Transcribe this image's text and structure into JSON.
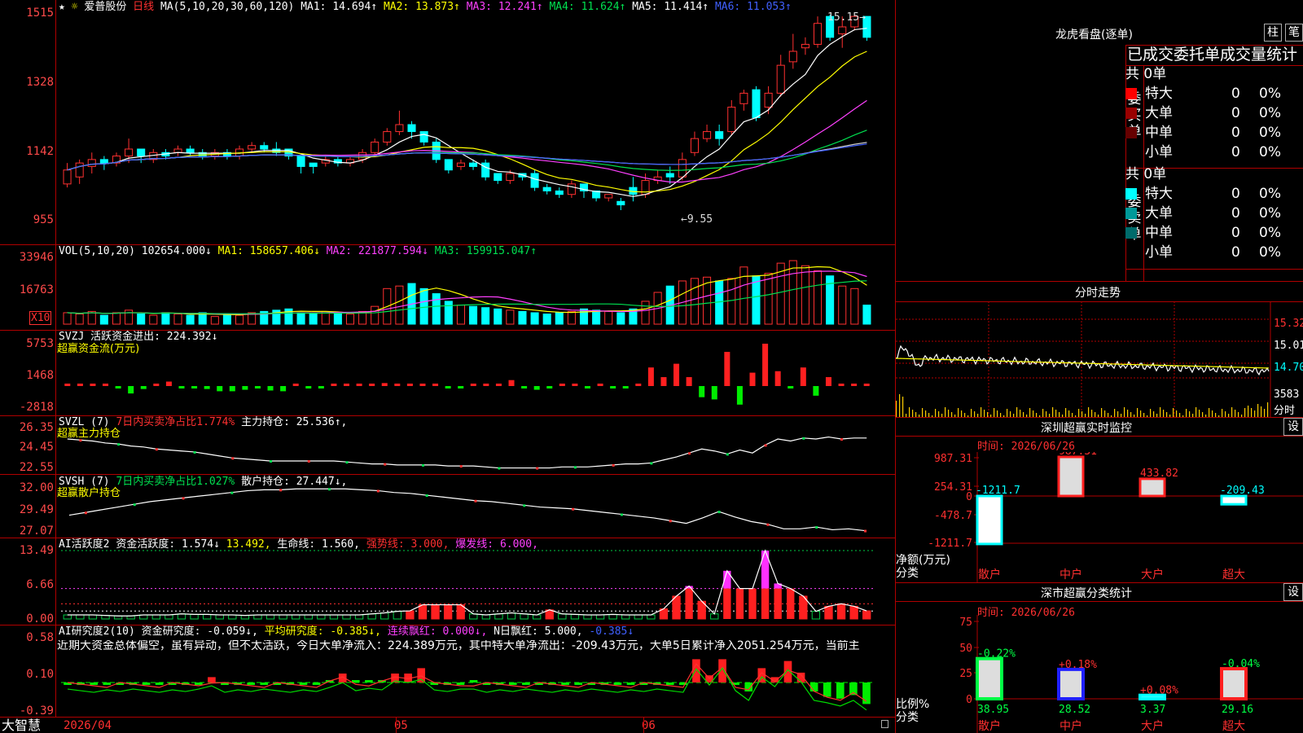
{
  "header": {
    "star": "★",
    "gear": "☼",
    "stock_name": "爱普股份",
    "period": "日线",
    "ma_label": "MA(5,10,20,30,60,120)",
    "ma1": "MA1: 14.694↑",
    "ma2": "MA2: 13.873↑",
    "ma3": "MA3: 12.241↑",
    "ma4": "MA4: 11.624↑",
    "ma5": "MA5: 11.414↑",
    "ma6": "MA6: 11.053↑"
  },
  "price_panel": {
    "ticks": [
      "1515",
      "1328",
      "1142",
      "955"
    ],
    "high_label": "15.15→",
    "low_label": "←9.55"
  },
  "vol_panel": {
    "title": "VOL(5,10,20)",
    "value": "102654.000↓",
    "ma1": "MA1: 158657.406↓",
    "ma2": "MA2: 221877.594↓",
    "ma3": "MA3: 159915.047↑",
    "ticks": [
      "33946",
      "16763"
    ],
    "unit": "X10"
  },
  "svzj_panel": {
    "title": "SVZJ",
    "desc": "活跃资金进出: 224.392↓",
    "sub": "超赢资金流(万元)",
    "ticks": [
      "5753",
      "1468",
      "-2818"
    ]
  },
  "svzl_panel": {
    "title": "SVZL (7)",
    "desc": "7日内买卖净占比1.774%",
    "desc2": "主力持仓: 25.536↑,",
    "sub": "超赢主力持仓",
    "ticks": [
      "26.35",
      "24.45",
      "22.55"
    ]
  },
  "svsh_panel": {
    "title": "SVSH (7)",
    "desc": "7日内买卖净占比1.027%",
    "desc2": "散户持仓: 27.447↓,",
    "sub": "超赢散户持仓",
    "ticks": [
      "32.00",
      "29.49",
      "27.07"
    ]
  },
  "ai1_panel": {
    "title": "AI活跃度2",
    "desc": "资金活跃度: 1.574↓",
    "v2": "13.492,",
    "v3": "生命线: 1.560,",
    "v4": "强势线: 3.000,",
    "v5": "爆发线: 6.000,",
    "ticks": [
      "13.49",
      "6.66",
      "0.00"
    ]
  },
  "ai2_panel": {
    "title": "AI研究度2(10)",
    "desc": "资金研究度: -0.059↓,",
    "v2": "平均研究度: -0.385↓,",
    "v3": "连续飘红: 0.000↓,",
    "v4": "N日飘红: 5.000,",
    "v5": "-0.385↓",
    "commentary": "近期大资金总体偏空，虽有异动，但不太活跃，今日大单净流入：224.389万元，其中特大单净流出：-209.43万元，大单5日累计净入2051.254万元，当前主",
    "ticks": [
      "0.58",
      "0.10",
      "-0.39"
    ]
  },
  "bottom_bar": {
    "brand": "大智慧",
    "date_start": "2026/04",
    "m05": "05",
    "m06": "06"
  },
  "longhu": {
    "title": "龙虎看盘(逐单)",
    "btn1": "柱",
    "btn2": "笔",
    "header": "已成交委托单成交量统计",
    "buy": {
      "label": "委买单",
      "total": "共 0单",
      "rows": [
        {
          "name": "特大",
          "v": "0",
          "p": "0%",
          "color": "#ff0000"
        },
        {
          "name": "大单",
          "v": "0",
          "p": "0%",
          "color": "#990000"
        },
        {
          "name": "中单",
          "v": "0",
          "p": "0%",
          "color": "#660000"
        },
        {
          "name": "小单",
          "v": "0",
          "p": "0%",
          "color": ""
        }
      ]
    },
    "sell": {
      "label": "委卖单",
      "total": "共 0单",
      "rows": [
        {
          "name": "特大",
          "v": "0",
          "p": "0%",
          "color": "#00ffff"
        },
        {
          "name": "大单",
          "v": "0",
          "p": "0%",
          "color": "#009999"
        },
        {
          "name": "中单",
          "v": "0",
          "p": "0%",
          "color": "#006b6b"
        },
        {
          "name": "小单",
          "v": "0",
          "p": "0%",
          "color": ""
        }
      ]
    }
  },
  "intraday": {
    "title": "分时走势",
    "ticks": [
      "15.32",
      "15.01",
      "14.70",
      "3583",
      "分时"
    ]
  },
  "sz_monitor": {
    "title": "深圳超赢实时监控",
    "btn": "设",
    "time": "时间: 2026/06/26",
    "yticks": [
      "987.31",
      "254.31",
      "0",
      "-478.7",
      "-1211.7"
    ],
    "ylabel": "净额(万元)",
    "xlabel": "分类",
    "bars": [
      {
        "cat": "散户",
        "value": -1211.7,
        "label": "-1211.7"
      },
      {
        "cat": "中户",
        "value": 987.31,
        "label": "987.31"
      },
      {
        "cat": "大户",
        "value": 433.82,
        "label": "433.82"
      },
      {
        "cat": "超大",
        "value": -209.43,
        "label": "-209.43"
      }
    ]
  },
  "sz_class": {
    "title": "深市超赢分类统计",
    "btn": "设",
    "time": "时间: 2026/06/26",
    "yticks": [
      "75",
      "50",
      "25",
      "0"
    ],
    "ylabel": "比例%",
    "xlabel": "分类",
    "bars": [
      {
        "cat": "散户",
        "value": 38.95,
        "change": "-0.22%",
        "color": "#00ff44"
      },
      {
        "cat": "中户",
        "value": 28.52,
        "change": "+0.18%",
        "color": "#2020ff"
      },
      {
        "cat": "大户",
        "value": 3.37,
        "change": "+0.08%",
        "color": "#00ffff"
      },
      {
        "cat": "超大",
        "value": 29.16,
        "change": "-0.04%",
        "color": "#ff2020"
      }
    ]
  },
  "chart_data": {
    "type": "candlestick",
    "title": "爱普股份 日线",
    "y_range": [
      9.55,
      15.15
    ],
    "x_months": [
      "2026/04",
      "05",
      "06"
    ],
    "candles": [
      [
        10.3,
        10.7,
        10.2,
        10.9
      ],
      [
        10.5,
        10.9,
        10.3,
        11.0
      ],
      [
        10.8,
        11.0,
        10.6,
        11.2
      ],
      [
        11.0,
        10.9,
        10.7,
        11.1
      ],
      [
        10.9,
        11.1,
        10.8,
        11.2
      ],
      [
        11.1,
        11.3,
        10.9,
        11.6
      ],
      [
        11.3,
        11.1,
        10.9,
        11.3
      ],
      [
        11.0,
        11.2,
        10.9,
        11.3
      ],
      [
        11.2,
        11.1,
        11.0,
        11.3
      ],
      [
        11.2,
        11.3,
        11.1,
        11.4
      ],
      [
        11.3,
        11.2,
        11.1,
        11.4
      ],
      [
        11.2,
        11.1,
        11.0,
        11.3
      ],
      [
        11.1,
        11.2,
        11.0,
        11.3
      ],
      [
        11.2,
        11.1,
        11.0,
        11.3
      ],
      [
        11.1,
        11.3,
        11.0,
        11.4
      ],
      [
        11.3,
        11.4,
        11.2,
        11.5
      ],
      [
        11.4,
        11.3,
        11.2,
        11.5
      ],
      [
        11.3,
        11.2,
        11.1,
        11.5
      ],
      [
        11.3,
        11.1,
        11.0,
        11.3
      ],
      [
        11.1,
        10.8,
        10.6,
        11.1
      ],
      [
        10.9,
        10.8,
        10.6,
        10.9
      ],
      [
        10.9,
        11.0,
        10.8,
        11.1
      ],
      [
        11.0,
        10.9,
        10.8,
        11.1
      ],
      [
        10.9,
        11.0,
        10.8,
        11.1
      ],
      [
        11.0,
        11.2,
        10.9,
        11.3
      ],
      [
        11.2,
        11.5,
        11.1,
        11.6
      ],
      [
        11.5,
        11.8,
        11.4,
        11.9
      ],
      [
        11.8,
        12.0,
        11.7,
        12.4
      ],
      [
        12.0,
        11.8,
        11.6,
        12.1
      ],
      [
        11.8,
        11.5,
        11.4,
        11.8
      ],
      [
        11.5,
        11.0,
        10.9,
        11.6
      ],
      [
        11.0,
        10.7,
        10.6,
        11.0
      ],
      [
        10.8,
        10.9,
        10.7,
        11.0
      ],
      [
        10.9,
        10.8,
        10.7,
        11.0
      ],
      [
        10.9,
        10.5,
        10.4,
        11.0
      ],
      [
        10.6,
        10.4,
        10.3,
        10.6
      ],
      [
        10.4,
        10.6,
        10.3,
        10.7
      ],
      [
        10.6,
        10.5,
        10.4,
        10.6
      ],
      [
        10.6,
        10.2,
        10.1,
        10.7
      ],
      [
        10.2,
        10.1,
        10.0,
        10.3
      ],
      [
        10.1,
        10.0,
        9.9,
        10.2
      ],
      [
        10.0,
        10.3,
        9.9,
        10.4
      ],
      [
        10.3,
        10.1,
        9.9,
        10.3
      ],
      [
        10.1,
        9.9,
        9.8,
        10.1
      ],
      [
        9.9,
        10.0,
        9.8,
        10.0
      ],
      [
        9.8,
        9.7,
        9.55,
        9.9
      ],
      [
        10.2,
        10.0,
        9.8,
        10.5
      ],
      [
        10.0,
        10.4,
        9.9,
        10.6
      ],
      [
        10.4,
        10.5,
        10.3,
        10.7
      ],
      [
        10.6,
        10.5,
        10.3,
        10.8
      ],
      [
        10.5,
        11.0,
        10.4,
        11.2
      ],
      [
        11.2,
        11.6,
        11.1,
        11.8
      ],
      [
        11.6,
        11.8,
        11.5,
        12.0
      ],
      [
        11.8,
        11.6,
        11.4,
        12.0
      ],
      [
        11.8,
        12.5,
        11.7,
        12.7
      ],
      [
        12.6,
        12.9,
        12.4,
        13.0
      ],
      [
        13.0,
        12.2,
        12.1,
        13.1
      ],
      [
        12.5,
        12.9,
        12.3,
        13.1
      ],
      [
        12.9,
        13.7,
        12.8,
        14.0
      ],
      [
        13.8,
        14.1,
        13.6,
        14.6
      ],
      [
        14.2,
        14.3,
        14.0,
        14.5
      ],
      [
        14.3,
        14.9,
        14.2,
        15.1
      ],
      [
        15.1,
        14.5,
        14.4,
        15.15
      ],
      [
        14.6,
        14.8,
        14.2,
        15.1
      ],
      [
        14.8,
        15.1,
        14.7,
        15.15
      ],
      [
        15.1,
        14.5,
        14.4,
        15.1
      ]
    ],
    "volume": [
      9000,
      8000,
      10000,
      7000,
      9000,
      11000,
      8000,
      7000,
      9000,
      8000,
      7000,
      9000,
      6000,
      8000,
      7000,
      9000,
      10000,
      11000,
      12000,
      9000,
      8000,
      10000,
      9000,
      8000,
      10000,
      14000,
      28000,
      30000,
      32000,
      28000,
      24000,
      18000,
      15000,
      14000,
      13000,
      12000,
      11000,
      10000,
      9000,
      8000,
      9000,
      10000,
      12000,
      11000,
      10000,
      9000,
      12000,
      18000,
      25000,
      30000,
      34000,
      36000,
      37000,
      34000,
      36000,
      45000,
      38000,
      40000,
      48000,
      50000,
      46000,
      42000,
      38000,
      30000,
      28000,
      15000
    ],
    "svzj": [
      0,
      0,
      0,
      0,
      -200,
      -1000,
      -400,
      0,
      600,
      -200,
      -300,
      -400,
      -700,
      -700,
      -500,
      -300,
      -600,
      -700,
      0,
      -200,
      -300,
      0,
      0,
      0,
      200,
      400,
      300,
      300,
      300,
      200,
      -200,
      -100,
      0,
      0,
      0,
      800,
      -200,
      -500,
      -100,
      300,
      0,
      -200,
      0,
      -100,
      -200,
      0,
      2500,
      1200,
      3000,
      1200,
      -1500,
      -1800,
      4600,
      -2500,
      1800,
      5700,
      2000,
      -300,
      2500,
      -1300,
      1200,
      300,
      0,
      0
    ],
    "svzl": [
      25.5,
      25.4,
      25.3,
      25.1,
      25.0,
      24.8,
      24.7,
      24.5,
      24.4,
      24.3,
      24.2,
      24.0,
      23.8,
      23.6,
      23.5,
      23.4,
      23.3,
      23.3,
      23.3,
      23.3,
      23.3,
      23.3,
      23.2,
      23.1,
      23.0,
      23.0,
      22.9,
      22.9,
      22.9,
      22.9,
      22.8,
      22.8,
      22.8,
      22.7,
      22.6,
      22.6,
      22.6,
      22.6,
      22.6,
      22.7,
      22.7,
      22.7,
      22.8,
      22.9,
      23.0,
      23.0,
      23.1,
      23.4,
      23.7,
      24.1,
      24.5,
      24.3,
      24.0,
      24.4,
      24.1,
      24.9,
      25.5,
      25.3,
      25.6,
      25.5,
      25.7,
      25.5,
      25.6,
      25.6
    ],
    "svsh": [
      29.1,
      29.4,
      29.7,
      30.0,
      30.3,
      30.6,
      30.8,
      31.0,
      31.2,
      31.4,
      31.6,
      31.8,
      31.9,
      31.9,
      32.0,
      32.0,
      32.0,
      32.0,
      31.9,
      31.8,
      31.6,
      31.5,
      31.3,
      31.1,
      30.9,
      30.7,
      30.6,
      30.4,
      30.2,
      30.0,
      29.9,
      29.8,
      29.6,
      29.4,
      29.2,
      29.0,
      28.8,
      28.5,
      28.2,
      28.8,
      29.5,
      28.9,
      28.4,
      28.1,
      27.6,
      27.6,
      27.8,
      27.5,
      27.6,
      27.4
    ],
    "ai1": [
      0.8,
      0.8,
      0.8,
      0.7,
      0.6,
      0.6,
      0.8,
      0.8,
      0.8,
      1.0,
      0.9,
      0.9,
      0.8,
      0.8,
      0.7,
      0.8,
      0.8,
      0.8,
      0.8,
      0.8,
      0.8,
      0.8,
      0.8,
      0.8,
      1.0,
      1.2,
      1.5,
      1.6,
      2.8,
      2.8,
      2.8,
      2.8,
      1.0,
      0.8,
      1.0,
      1.2,
      1.0,
      0.8,
      1.8,
      1.0,
      0.9,
      0.8,
      0.8,
      0.9,
      0.8,
      0.8,
      0.8,
      2.0,
      4.5,
      6.5,
      3.5,
      1.0,
      9.5,
      6.0,
      6.0,
      13.49,
      7.0,
      6.0,
      4.5,
      1.5,
      2.5,
      3.0,
      2.5,
      1.6
    ],
    "ai2": [
      0.04,
      0.04,
      0.04,
      0.04,
      0.04,
      0.04,
      0.04,
      0.04,
      0.04,
      0.04,
      0.04,
      0.1,
      0.04,
      0.04,
      0.04,
      0.04,
      0.04,
      0.04,
      0.04,
      0.04,
      0.06,
      0.14,
      0.06,
      0.06,
      0.06,
      0.14,
      0.14,
      0.2,
      0.04,
      0.04,
      0.04,
      0.06,
      0.04,
      0.04,
      0.04,
      0.04,
      0.04,
      0.04,
      0.04,
      0.04,
      0.04,
      0.04,
      0.04,
      0.04,
      0.04,
      0.04,
      0.04,
      0.04,
      0.3,
      0.12,
      0.3,
      0.04,
      -0.06,
      0.2,
      0.1,
      0.28,
      0.15,
      -0.06,
      -0.12,
      -0.14,
      -0.1,
      -0.2
    ]
  }
}
